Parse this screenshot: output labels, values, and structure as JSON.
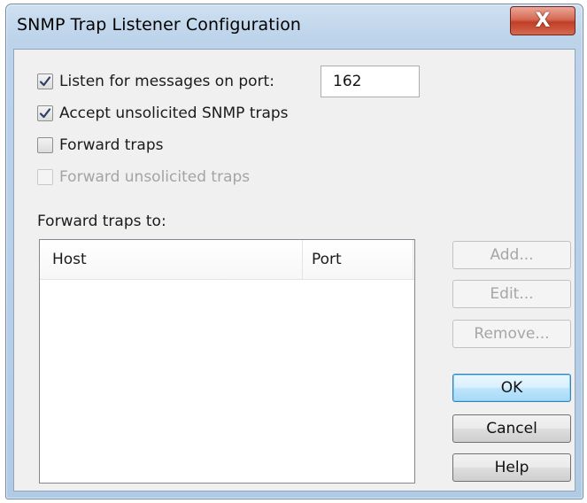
{
  "window": {
    "title": "SNMP Trap Listener Configuration",
    "close_glyph": "X",
    "close_icon": "close-icon"
  },
  "options": {
    "listen": {
      "label": "Listen for messages on port:",
      "checked": true,
      "enabled": true
    },
    "port_value": "162",
    "accept_unsolicited": {
      "label": "Accept unsolicited SNMP traps",
      "checked": true,
      "enabled": true
    },
    "forward_traps": {
      "label": "Forward traps",
      "checked": false,
      "enabled": true
    },
    "forward_unsolicited": {
      "label": "Forward unsolicited traps",
      "checked": false,
      "enabled": false
    }
  },
  "forward_list": {
    "label": "Forward traps to:",
    "columns": [
      "Host",
      "Port"
    ],
    "rows": []
  },
  "buttons": {
    "add": "Add...",
    "edit": "Edit...",
    "remove": "Remove...",
    "ok": "OK",
    "cancel": "Cancel",
    "help": "Help"
  },
  "colors": {
    "title_bar": "#bcd3ea",
    "close_button": "#c13e26",
    "dialog_background": "#f0f0f0",
    "default_button": "#bee6fd",
    "disabled_text": "#a4a4a4"
  }
}
